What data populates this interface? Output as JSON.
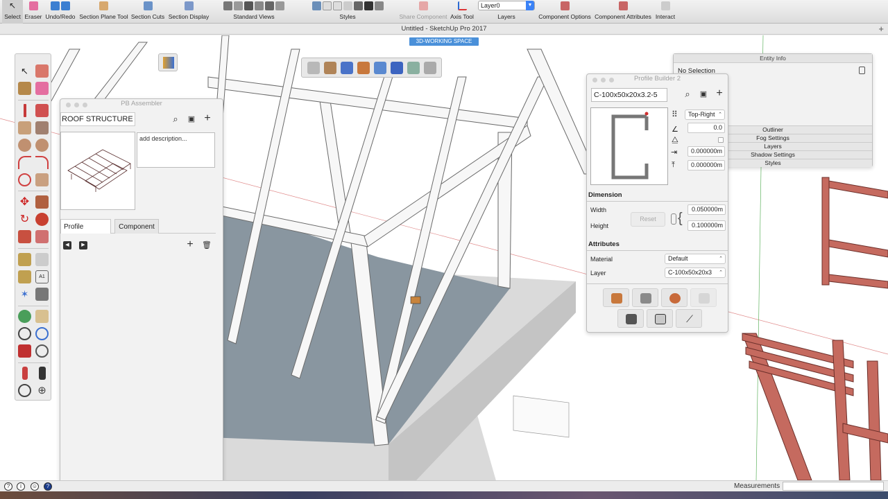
{
  "app": {
    "window_title": "Untitled - SketchUp Pro 2017",
    "scene_tab": "3D-WORKING SPACE",
    "plus": "+"
  },
  "toolbar": {
    "groups": [
      {
        "label": "Select",
        "selected": true
      },
      {
        "label": "Eraser"
      },
      {
        "label": "Undo/Redo"
      },
      {
        "label": "Section Plane Tool"
      },
      {
        "label": "Section Cuts"
      },
      {
        "label": "Section Display"
      },
      {
        "label": "Standard Views"
      },
      {
        "label": "Styles"
      },
      {
        "label": "Share Component",
        "disabled": true
      },
      {
        "label": "Axis Tool"
      },
      {
        "label": "Layers"
      },
      {
        "label": "Component Options"
      },
      {
        "label": "Component Attributes"
      },
      {
        "label": "Interact"
      }
    ],
    "layer_value": "Layer0"
  },
  "assembler": {
    "title": "PB Assembler",
    "name": "ROOF STRUCTURE",
    "description": "add description...",
    "tabs": [
      "Profile Member",
      "Component"
    ]
  },
  "entity_info": {
    "title": "Entity Info",
    "selection": "No Selection",
    "sections": [
      "Outliner",
      "Fog Settings",
      "Layers",
      "Shadow Settings",
      "Styles"
    ]
  },
  "profile_builder": {
    "title": "Profile Builder 2",
    "profile_name": "C-100x50x20x3.2-5",
    "alignment": "Top-Right",
    "rotation": "0.0",
    "offset_x": "0.000000m",
    "offset_y": "0.000000m",
    "dimension_heading": "Dimension",
    "width_label": "Width",
    "width_value": "0.050000m",
    "height_label": "Height",
    "height_value": "0.100000m",
    "reset_label": "Reset",
    "attributes_heading": "Attributes",
    "material_label": "Material",
    "material_value": "Default",
    "layer_label": "Layer",
    "layer_value": "C-100x50x20x3"
  },
  "status": {
    "measurements_label": "Measurements"
  },
  "colors": {
    "floor": "#8996a0",
    "slab": "#dcdcdc",
    "steel": "#c56a5f",
    "accent": "#3b82f6"
  }
}
